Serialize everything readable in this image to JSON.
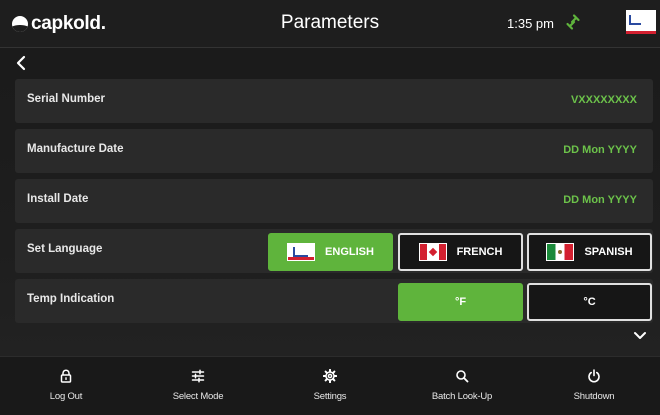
{
  "header": {
    "brand": "capkold.",
    "title": "Parameters",
    "time": "1:35 pm",
    "icons": {
      "connection": "link-icon",
      "language": "english-flag-icon"
    }
  },
  "rows": {
    "serial": {
      "label": "Serial Number",
      "value": "VXXXXXXXX"
    },
    "manufacture": {
      "label": "Manufacture Date",
      "value": "DD Mon YYYY"
    },
    "install": {
      "label": "Install Date",
      "value": "DD Mon YYYY"
    },
    "language": {
      "label": "Set Language",
      "options": [
        {
          "label": "ENGLISH",
          "selected": true
        },
        {
          "label": "FRENCH",
          "selected": false
        },
        {
          "label": "SPANISH",
          "selected": false
        }
      ]
    },
    "temp": {
      "label": "Temp Indication",
      "options": [
        {
          "label": "°F",
          "selected": true
        },
        {
          "label": "°C",
          "selected": false
        }
      ]
    }
  },
  "nav": [
    {
      "label": "Log Out",
      "icon": "lock-icon"
    },
    {
      "label": "Select Mode",
      "icon": "sliders-icon"
    },
    {
      "label": "Settings",
      "icon": "gear-icon"
    },
    {
      "label": "Batch Look-Up",
      "icon": "search-icon"
    },
    {
      "label": "Shutdown",
      "icon": "power-icon"
    }
  ],
  "colors": {
    "accent": "#5fb43c",
    "value_text": "#6cc24a",
    "row_bg": "#2a2a2a",
    "background": "#1b1b1b"
  }
}
